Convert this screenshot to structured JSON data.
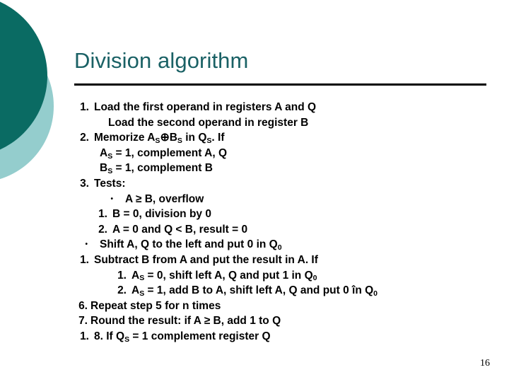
{
  "slide": {
    "title": "Division algorithm",
    "page_number": "16",
    "title_color": "#1a6165",
    "rule_color": "#000000",
    "background_color": "#ffffff",
    "decoration": {
      "dark_circle_color": "#0a6b63",
      "light_circle_color": "#94cdcd"
    }
  },
  "body": {
    "lines": [
      {
        "marker": "1.",
        "text_a": "Load the first operand in registers A and Q"
      },
      {
        "marker": "",
        "text_a": "Load the second operand in register B"
      },
      {
        "marker": "2.",
        "text_a": "Memorize A",
        "sub_a": "S",
        "op": "⊕",
        "text_b": "B",
        "sub_b": "S",
        "text_c": " in Q",
        "sub_c": "S",
        "text_d": ". If"
      },
      {
        "marker": "",
        "text_a": "A",
        "sub_a": "S",
        "text_b": " = 1, complement A, Q"
      },
      {
        "marker": "",
        "text_a": "B",
        "sub_a": "S",
        "text_b": " = 1, complement B"
      },
      {
        "marker": "3.",
        "text_a": "Tests:"
      },
      {
        "marker": "•",
        "text_a": "A ≥ B, overflow"
      },
      {
        "marker": "1.",
        "text_a": "B = 0, division by 0"
      },
      {
        "marker": "2.",
        "text_a": "A = 0 and Q < B, result = 0"
      },
      {
        "marker": "•",
        "text_a": "Shift A, Q to the left and put 0 in Q",
        "sub_a": "0"
      },
      {
        "marker": "1.",
        "text_a": "Subtract B from A and put the result in A. If"
      },
      {
        "marker": "1.",
        "text_a": "A",
        "sub_a": "S",
        "text_b": " = 0, shift left A, Q and put 1 in Q",
        "sub_b": "0"
      },
      {
        "marker": "2.",
        "text_a": "A",
        "sub_a": "S",
        "text_b": " = 1, add B to A, shift left A, Q and put 0 în Q",
        "sub_b": "0"
      },
      {
        "marker": "6.",
        "text_a": "Repeat step 5 for n times"
      },
      {
        "marker": "7.",
        "text_a": "Round the result: if A ≥ B, add 1 to Q"
      },
      {
        "marker": "1.",
        "text_a": "8. If Q",
        "sub_a": "S",
        "text_b": " = 1 complement register Q"
      }
    ]
  }
}
